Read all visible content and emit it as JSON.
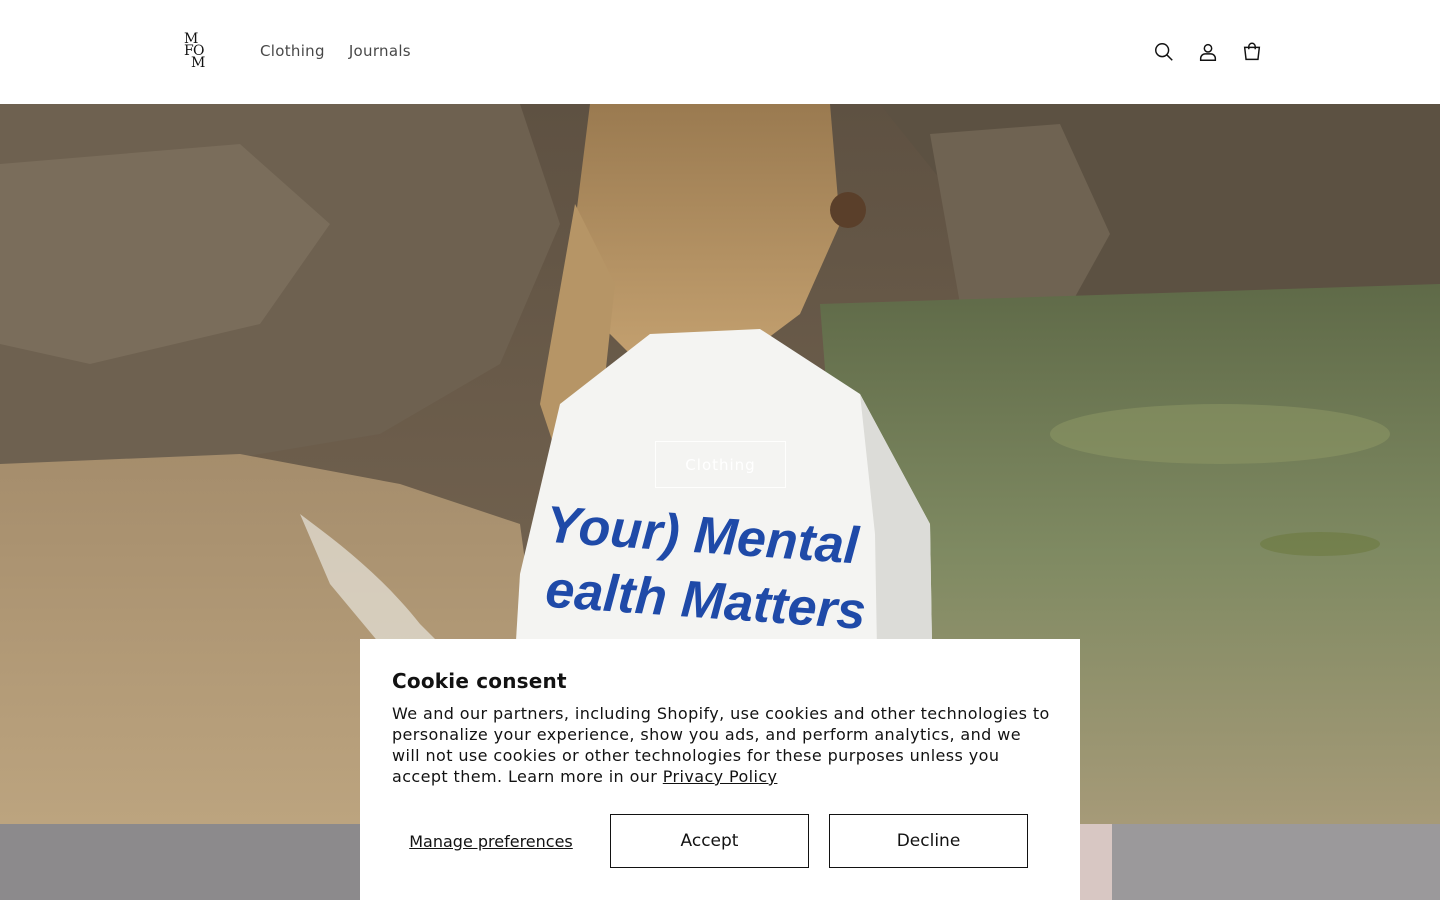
{
  "header": {
    "logo_text": "MFOM",
    "logo_letters": [
      "M",
      "F",
      "O",
      "M"
    ],
    "nav": [
      {
        "label": "Clothing"
      },
      {
        "label": "Journals"
      }
    ],
    "icons": [
      "search-icon",
      "account-icon",
      "cart-icon"
    ]
  },
  "hero": {
    "button_label": "Clothing",
    "shirt_text_line1": "Your) Mental",
    "shirt_text_line2": "ealth Matters"
  },
  "cookie": {
    "title": "Cookie consent",
    "body": "We and our partners, including Shopify, use cookies and other technologies to personalize your experience, show you ads, and perform analytics, and we will not use cookies or other technologies for these purposes unless you accept them. Learn more in our ",
    "privacy_link": "Privacy Policy",
    "manage_label": "Manage preferences",
    "accept_label": "Accept",
    "decline_label": "Decline"
  },
  "colors": {
    "text": "#121212",
    "background": "#ffffff",
    "shirt_print": "#1f4aa8"
  }
}
